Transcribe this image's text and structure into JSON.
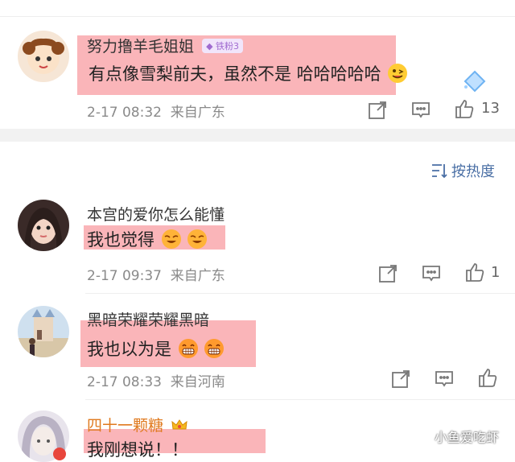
{
  "comments": [
    {
      "name": "努力撸羊毛姐姐",
      "badge": "铁粉3",
      "text": "有点像雪梨前夫，虽然不是 哈哈哈哈哈",
      "time": "2-17 08:32",
      "location": "来自广东",
      "likes": "13"
    },
    {
      "name": "本宫的爱你怎么能懂",
      "text": "我也觉得",
      "time": "2-17 09:37",
      "location": "来自广东",
      "likes": "1"
    },
    {
      "name": "黑暗荣耀荣耀黑暗",
      "text": "我也以为是",
      "time": "2-17 08:33",
      "location": "来自河南",
      "likes": ""
    },
    {
      "name": "四十一颗糖",
      "text": "我刚想说！！"
    }
  ],
  "sort": {
    "label": "按热度"
  },
  "watermark": "小鱼爱吃虾",
  "colors": {
    "highlight": "#f9a8ad",
    "vip_name": "#e07a1f",
    "divider": "#f0f0f0"
  },
  "icons": [
    "share-icon",
    "comment-icon",
    "like-icon",
    "sort-icon",
    "crown-icon",
    "diamond-icon"
  ]
}
